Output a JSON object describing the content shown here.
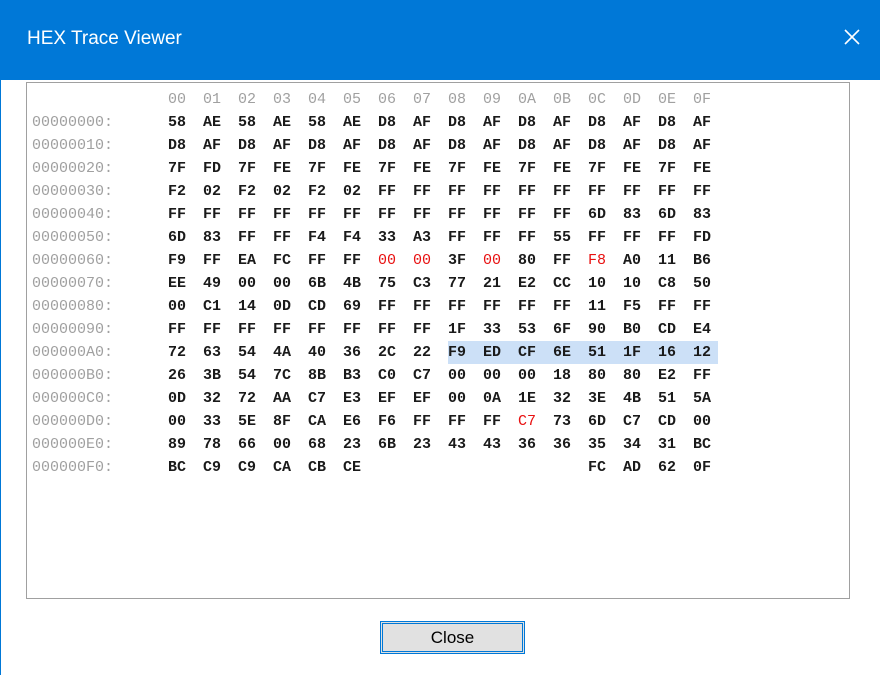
{
  "window": {
    "title": "HEX Trace Viewer",
    "close_icon": "close-icon"
  },
  "hex": {
    "header": [
      "00",
      "01",
      "02",
      "03",
      "04",
      "05",
      "06",
      "07",
      "08",
      "09",
      "0A",
      "0B",
      "0C",
      "0D",
      "0E",
      "0F"
    ],
    "rows": [
      {
        "addr": "00000000:",
        "bytes": [
          "58",
          "AE",
          "58",
          "AE",
          "58",
          "AE",
          "D8",
          "AF",
          "D8",
          "AF",
          "D8",
          "AF",
          "D8",
          "AF",
          "D8",
          "AF"
        ]
      },
      {
        "addr": "00000010:",
        "bytes": [
          "D8",
          "AF",
          "D8",
          "AF",
          "D8",
          "AF",
          "D8",
          "AF",
          "D8",
          "AF",
          "D8",
          "AF",
          "D8",
          "AF",
          "D8",
          "AF"
        ]
      },
      {
        "addr": "00000020:",
        "bytes": [
          "7F",
          "FD",
          "7F",
          "FE",
          "7F",
          "FE",
          "7F",
          "FE",
          "7F",
          "FE",
          "7F",
          "FE",
          "7F",
          "FE",
          "7F",
          "FE"
        ]
      },
      {
        "addr": "00000030:",
        "bytes": [
          "F2",
          "02",
          "F2",
          "02",
          "F2",
          "02",
          "FF",
          "FF",
          "FF",
          "FF",
          "FF",
          "FF",
          "FF",
          "FF",
          "FF",
          "FF"
        ]
      },
      {
        "addr": "00000040:",
        "bytes": [
          "FF",
          "FF",
          "FF",
          "FF",
          "FF",
          "FF",
          "FF",
          "FF",
          "FF",
          "FF",
          "FF",
          "FF",
          "6D",
          "83",
          "6D",
          "83"
        ]
      },
      {
        "addr": "00000050:",
        "bytes": [
          "6D",
          "83",
          "FF",
          "FF",
          "F4",
          "F4",
          "33",
          "A3",
          "FF",
          "FF",
          "FF",
          "55",
          "FF",
          "FF",
          "FF",
          "FD"
        ]
      },
      {
        "addr": "00000060:",
        "bytes": [
          "F9",
          "FF",
          "EA",
          "FC",
          "FF",
          "FF",
          "00",
          "00",
          "3F",
          "00",
          "80",
          "FF",
          "F8",
          "A0",
          "11",
          "B6"
        ]
      },
      {
        "addr": "00000070:",
        "bytes": [
          "EE",
          "49",
          "00",
          "00",
          "6B",
          "4B",
          "75",
          "C3",
          "77",
          "21",
          "E2",
          "CC",
          "10",
          "10",
          "C8",
          "50"
        ]
      },
      {
        "addr": "00000080:",
        "bytes": [
          "00",
          "C1",
          "14",
          "0D",
          "CD",
          "69",
          "FF",
          "FF",
          "FF",
          "FF",
          "FF",
          "FF",
          "11",
          "F5",
          "FF",
          "FF"
        ]
      },
      {
        "addr": "00000090:",
        "bytes": [
          "FF",
          "FF",
          "FF",
          "FF",
          "FF",
          "FF",
          "FF",
          "FF",
          "1F",
          "33",
          "53",
          "6F",
          "90",
          "B0",
          "CD",
          "E4"
        ]
      },
      {
        "addr": "000000A0:",
        "bytes": [
          "72",
          "63",
          "54",
          "4A",
          "40",
          "36",
          "2C",
          "22",
          "F9",
          "ED",
          "CF",
          "6E",
          "51",
          "1F",
          "16",
          "12"
        ]
      },
      {
        "addr": "000000B0:",
        "bytes": [
          "26",
          "3B",
          "54",
          "7C",
          "8B",
          "B3",
          "C0",
          "C7",
          "00",
          "00",
          "00",
          "18",
          "80",
          "80",
          "E2",
          "FF"
        ]
      },
      {
        "addr": "000000C0:",
        "bytes": [
          "0D",
          "32",
          "72",
          "AA",
          "C7",
          "E3",
          "EF",
          "EF",
          "00",
          "0A",
          "1E",
          "32",
          "3E",
          "4B",
          "51",
          "5A"
        ]
      },
      {
        "addr": "000000D0:",
        "bytes": [
          "00",
          "33",
          "5E",
          "8F",
          "CA",
          "E6",
          "F6",
          "FF",
          "FF",
          "FF",
          "C7",
          "73",
          "6D",
          "C7",
          "CD",
          "00"
        ]
      },
      {
        "addr": "000000E0:",
        "bytes": [
          "89",
          "78",
          "66",
          "00",
          "68",
          "23",
          "6B",
          "23",
          "43",
          "43",
          "36",
          "36",
          "35",
          "34",
          "31",
          "BC"
        ]
      },
      {
        "addr": "000000F0:",
        "bytes": [
          "BC",
          "C9",
          "C9",
          "CA",
          "CB",
          "CE",
          "",
          "",
          "",
          "",
          "",
          "",
          "FC",
          "AD",
          "62",
          "0F"
        ]
      }
    ],
    "red_cells": [
      [
        6,
        6
      ],
      [
        6,
        7
      ],
      [
        6,
        9
      ],
      [
        6,
        12
      ],
      [
        13,
        10
      ]
    ],
    "selected_range": {
      "row": 10,
      "from_col": 8,
      "to_col": 15
    }
  },
  "buttons": {
    "close_label": "Close"
  },
  "colors": {
    "titlebar": "#0078d7",
    "highlight": "#cce0f7",
    "changed_byte": "#e81010",
    "address": "#a0a0a0"
  }
}
